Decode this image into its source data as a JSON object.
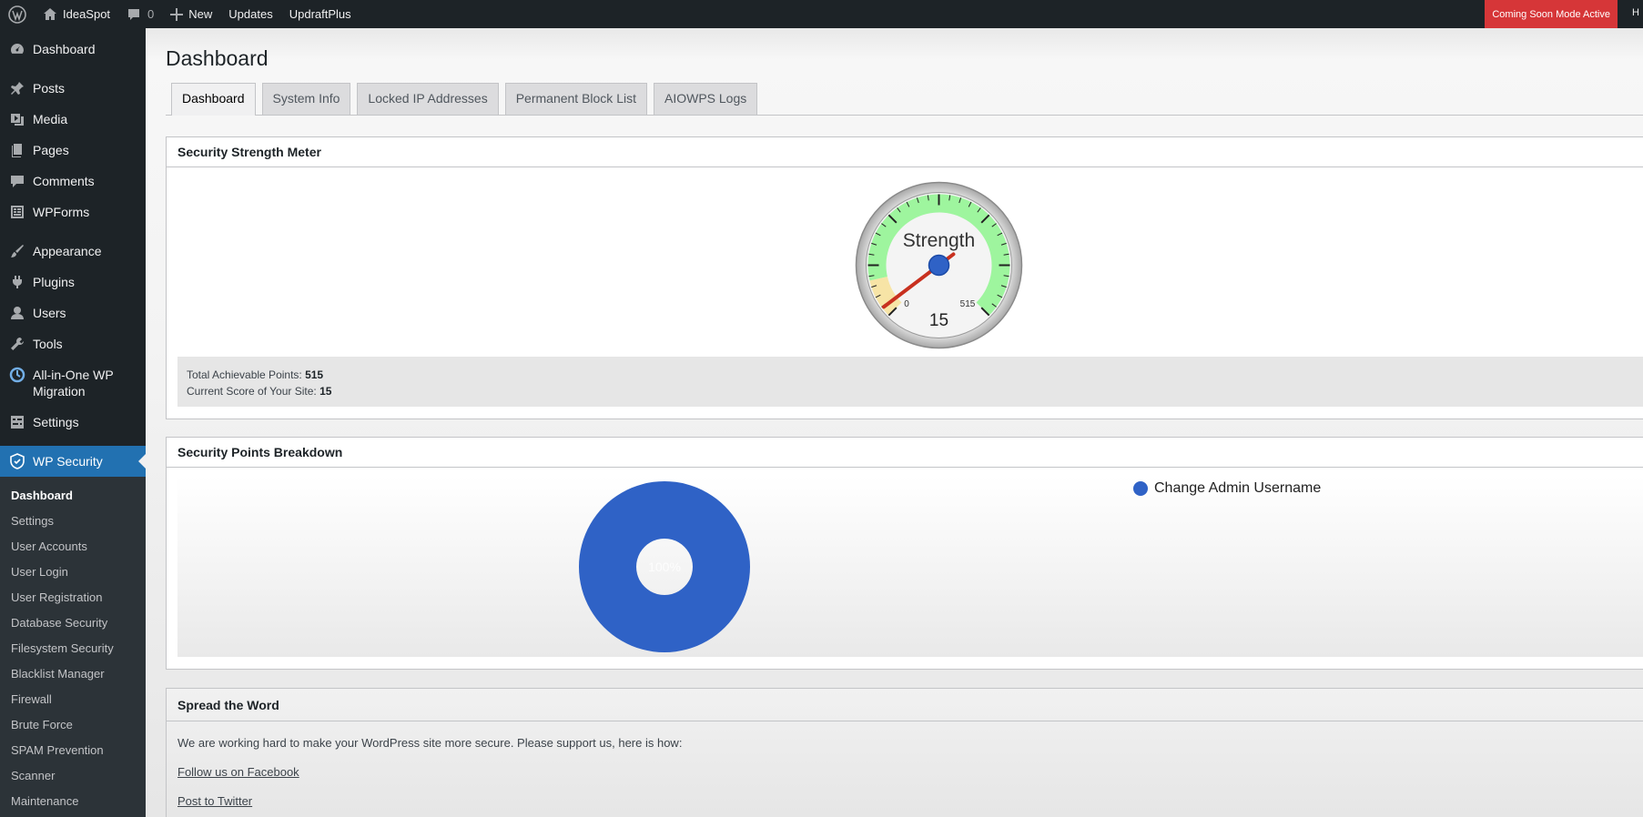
{
  "adminbar": {
    "site_name": "IdeaSpot",
    "comments_count": "0",
    "new_label": "New",
    "updates_label": "Updates",
    "plugin_label": "UpdraftPlus",
    "coming_soon": "Coming Soon Mode Active",
    "cut_text": "H"
  },
  "sidebar": {
    "items": [
      {
        "label": "Dashboard",
        "icon": "dashboard-icon"
      },
      {
        "label": "Posts",
        "icon": "pin-icon"
      },
      {
        "label": "Media",
        "icon": "media-icon"
      },
      {
        "label": "Pages",
        "icon": "pages-icon"
      },
      {
        "label": "Comments",
        "icon": "comment-icon"
      },
      {
        "label": "WPForms",
        "icon": "forms-icon"
      },
      {
        "label": "Appearance",
        "icon": "brush-icon"
      },
      {
        "label": "Plugins",
        "icon": "plug-icon"
      },
      {
        "label": "Users",
        "icon": "user-icon"
      },
      {
        "label": "Tools",
        "icon": "wrench-icon"
      },
      {
        "label": "All-in-One WP Migration",
        "icon": "migration-icon"
      },
      {
        "label": "Settings",
        "icon": "settings-icon"
      },
      {
        "label": "WP Security",
        "icon": "shield-icon"
      }
    ],
    "submenu": [
      "Dashboard",
      "Settings",
      "User Accounts",
      "User Login",
      "User Registration",
      "Database Security",
      "Filesystem Security",
      "Blacklist Manager",
      "Firewall",
      "Brute Force",
      "SPAM Prevention",
      "Scanner",
      "Maintenance"
    ]
  },
  "main": {
    "title": "Dashboard",
    "tabs": [
      "Dashboard",
      "System Info",
      "Locked IP Addresses",
      "Permanent Block List",
      "AIOWPS Logs"
    ],
    "meter": {
      "heading": "Security Strength Meter",
      "gauge_label": "Strength",
      "gauge_min": "0",
      "gauge_max": "515",
      "gauge_value": "15",
      "value": 15,
      "max": 515,
      "total_label": "Total Achievable Points: ",
      "total_value": "515",
      "current_label": "Current Score of Your Site: ",
      "current_value": "15"
    },
    "breakdown": {
      "heading": "Security Points Breakdown",
      "slice_label": "100%",
      "legend_label": "Change Admin Username",
      "color": "#2f62c6"
    },
    "spread": {
      "heading": "Spread the Word",
      "text": "We are working hard to make your WordPress site more secure. Please support us, here is how:",
      "link1": "Follow us on Facebook",
      "link2": "Post to Twitter"
    }
  },
  "colors": {
    "adminbar": "#1d2327",
    "accent": "#2271b1",
    "coming_soon": "#d63638",
    "gauge_green": "#9ef59e",
    "gauge_yellow": "#f7e4a6",
    "needle": "#c8301f"
  }
}
